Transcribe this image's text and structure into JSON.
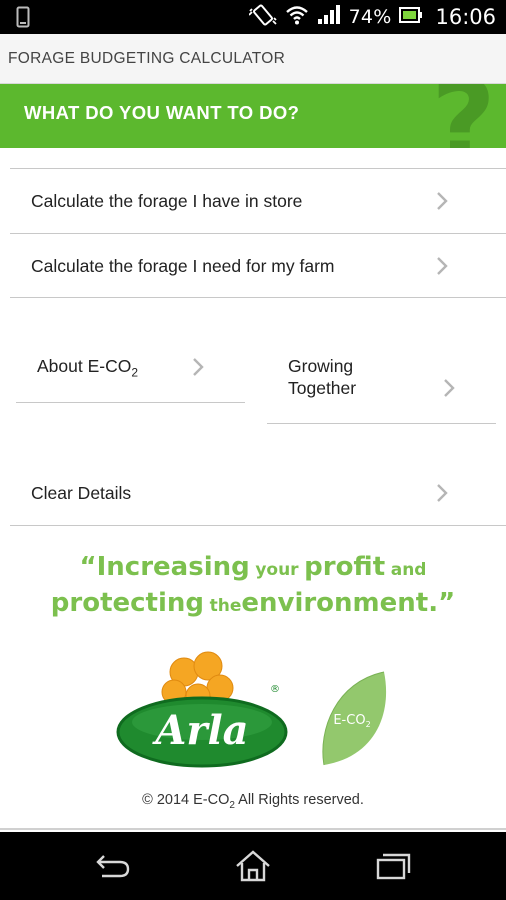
{
  "status_bar": {
    "battery_text": "74%",
    "time": "16:06",
    "icons": [
      "phone-icon",
      "vibrate-icon",
      "wifi-icon",
      "signal-icon",
      "battery-icon"
    ]
  },
  "app": {
    "title": "FORAGE BUDGETING CALCULATOR"
  },
  "banner": {
    "heading": "WHAT DO YOU WANT TO DO?",
    "decoration": "?"
  },
  "menu": {
    "store": "Calculate the forage I have in store",
    "need": "Calculate the forage I need for my farm",
    "about_prefix": "About E-CO",
    "about_sub": "2",
    "growing_line1": "Growing",
    "growing_line2": "Together",
    "clear": "Clear Details"
  },
  "slogan": {
    "open_quote": "“",
    "w1": "Increasing",
    "w2": "your",
    "w3": "profit",
    "w4": "and",
    "w5": "protecting",
    "w6": "the",
    "w7": "environment.",
    "close_quote": "”"
  },
  "logos": {
    "arla": "Arla",
    "arla_mark": "®",
    "eco_prefix": "E-CO",
    "eco_sub": "2"
  },
  "footer": {
    "copyright_prefix": "© 2014 E-CO",
    "copyright_sub": "2",
    "copyright_suffix": " All Rights reserved."
  },
  "colors": {
    "banner_green": "#5cb82e",
    "slogan_green": "#7cc04e",
    "arla_green": "#1f8a2e",
    "arla_flower": "#f5a623"
  }
}
